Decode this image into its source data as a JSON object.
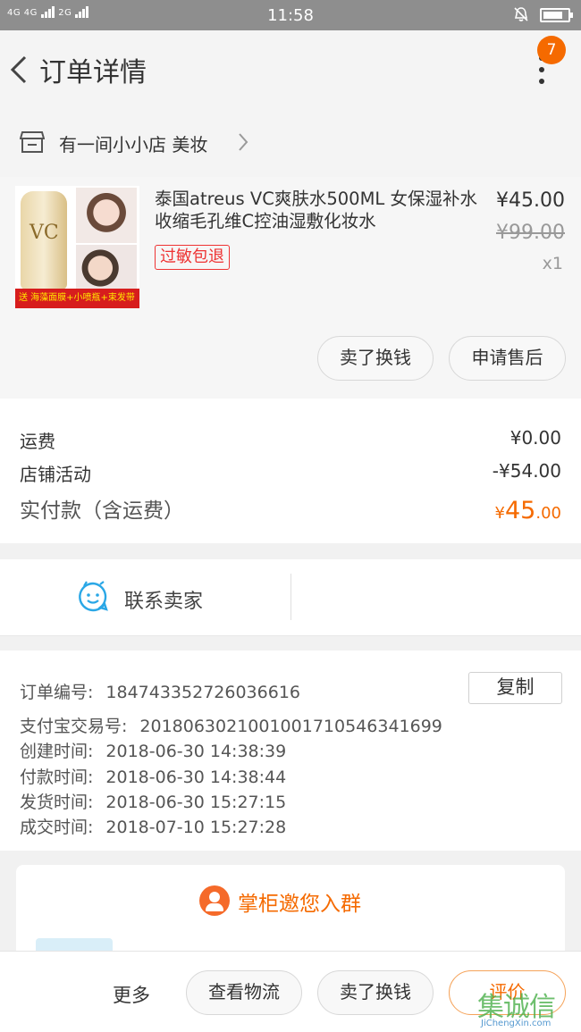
{
  "status_bar": {
    "network_left": "4G 4G",
    "network_right": "2G",
    "time": "11:58",
    "battery_level": 0.8
  },
  "nav": {
    "title": "订单详情",
    "badge_count": "7"
  },
  "shop": {
    "name": "有一间小小店 美妆"
  },
  "product": {
    "name": "泰国atreus VC爽肤水500ML 女保湿补水收缩毛孔维C控油湿敷化妆水",
    "tag": "过敏包退",
    "price": "¥45.00",
    "original_price": "¥99.00",
    "quantity": "x1",
    "thumb_promo": "送 海藻面膜+小喷瓶+束发带",
    "thumb_logo": "VC",
    "sell_button": "卖了换钱",
    "after_sale_button": "申请售后"
  },
  "fees": {
    "shipping_label": "运费",
    "shipping_value": "¥0.00",
    "activity_label": "店铺活动",
    "activity_value": "-¥54.00",
    "paid_label": "实付款（含运费）",
    "paid_currency": "¥",
    "paid_int": "45",
    "paid_dec": ".00"
  },
  "contact": {
    "label": "联系卖家"
  },
  "order_info": {
    "order_no_label": "订单编号:",
    "order_no": "184743352726036616",
    "copy_button": "复制",
    "alipay_label": "支付宝交易号:",
    "alipay_no": "2018063021001001710546341699",
    "created_label": "创建时间:",
    "created": "2018-06-30 14:38:39",
    "paid_label": "付款时间:",
    "paid": "2018-06-30 14:38:44",
    "shipped_label": "发货时间:",
    "shipped": "2018-06-30 15:27:15",
    "closed_label": "成交时间:",
    "closed": "2018-07-10 15:27:28"
  },
  "group": {
    "text": "掌柜邀您入群"
  },
  "bottom_bar": {
    "more": "更多",
    "logistics_button": "查看物流",
    "sell_button": "卖了换钱",
    "rate_button": "评价"
  },
  "watermark": {
    "main": "集诚信",
    "sub": "JiChengXin.com"
  },
  "colors": {
    "accent": "#f56a00",
    "tag_red": "#e33333",
    "contact_blue": "#2aa7e6"
  }
}
